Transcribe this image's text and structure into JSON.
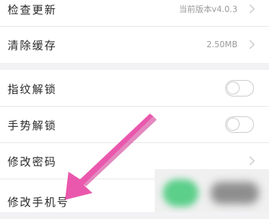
{
  "settings": {
    "rows": [
      {
        "label": "检查更新",
        "value": "当前版本v4.0.3"
      },
      {
        "label": "清除缓存",
        "value": "2.50MB"
      },
      {
        "label": "指纹解锁"
      },
      {
        "label": "手势解锁"
      },
      {
        "label": "修改密码"
      },
      {
        "label": "修改手机号"
      }
    ]
  },
  "colors": {
    "background": "#f2f2f4",
    "row": "#ffffff",
    "arrow": "#e84aa6",
    "blur_green": "#5ccf8a"
  },
  "icons": [
    "chevron-right-icon",
    "toggle-switch",
    "pointer-arrow"
  ]
}
